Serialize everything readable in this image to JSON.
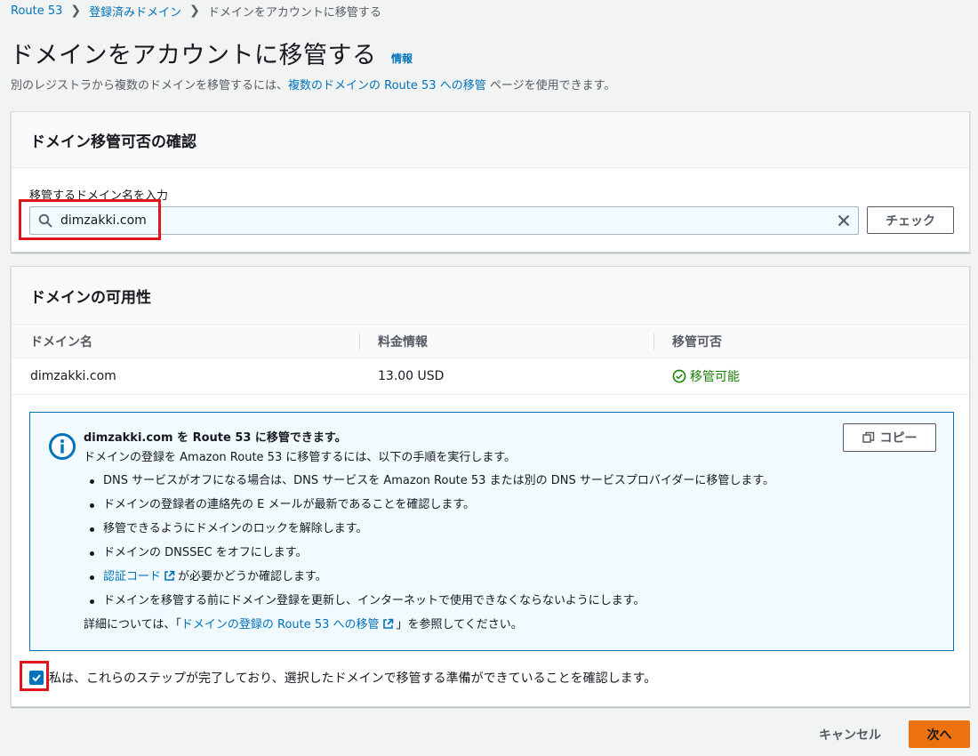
{
  "breadcrumb": {
    "items": [
      {
        "label": "Route 53"
      },
      {
        "label": "登録済みドメイン"
      },
      {
        "label": "ドメインをアカウントに移管する"
      }
    ]
  },
  "page": {
    "title": "ドメインをアカウントに移管する",
    "info_link": "情報",
    "description_before": "別のレジストラから複数のドメインを移管するには、",
    "description_link": "複数のドメインの Route 53 への移管",
    "description_after": " ページを使用できます。"
  },
  "check_panel": {
    "header": "ドメイン移管可否の確認",
    "field_label": "移管するドメイン名を入力",
    "search_value": "dimzakki.com",
    "check_button": "チェック"
  },
  "availability_panel": {
    "header": "ドメインの可用性",
    "columns": [
      "ドメイン名",
      "料金情報",
      "移管可否"
    ],
    "rows": [
      {
        "domain": "dimzakki.com",
        "price": "13.00 USD",
        "status": "移管可能"
      }
    ]
  },
  "alert": {
    "title": "dimzakki.com を Route 53 に移管できます。",
    "intro": "ドメインの登録を Amazon Route 53 に移管するには、以下の手順を実行します。",
    "steps": [
      "DNS サービスがオフになる場合は、DNS サービスを Amazon Route 53 または別の DNS サービスプロバイダーに移管します。",
      "ドメインの登録者の連絡先の E メールが最新であることを確認します。",
      "移管できるようにドメインのロックを解除します。",
      "ドメインの DNSSEC をオフにします。"
    ],
    "auth_code_link": "認証コード",
    "auth_code_text": "が必要かどうか確認します。",
    "last_step": "ドメインを移管する前にドメイン登録を更新し、インターネットで使用できなくならないようにします。",
    "details_before": "詳細については、「",
    "details_link": "ドメインの登録の Route 53 への移管",
    "details_after": "」を参照してください。",
    "copy_button": "コピー"
  },
  "confirm": {
    "label": "私は、これらのステップが完了しており、選択したドメインで移管する準備ができていることを確認します。",
    "checked": true
  },
  "footer": {
    "cancel": "キャンセル",
    "next": "次へ"
  },
  "colors": {
    "link": "#0073bb",
    "success": "#1d8102",
    "primary_button": "#ec7211",
    "highlight": "#e0161a"
  }
}
